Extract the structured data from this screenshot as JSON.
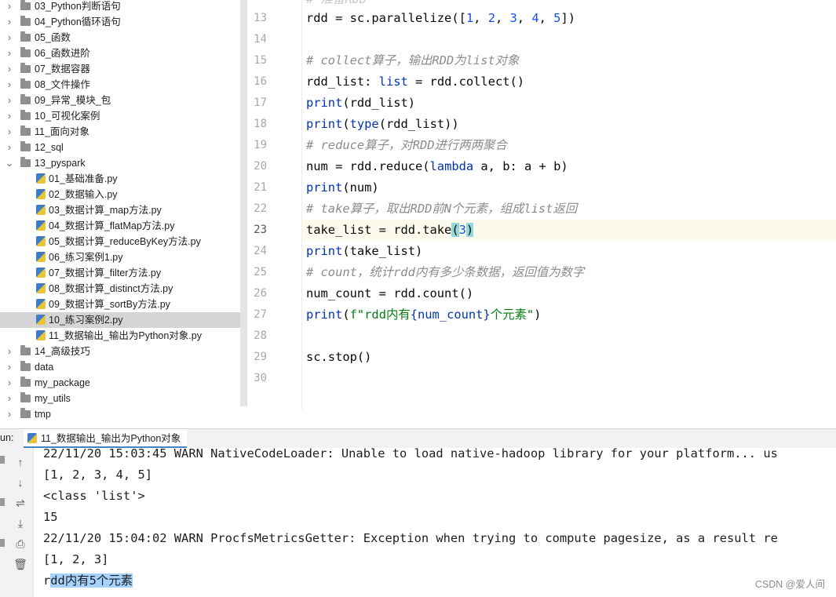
{
  "project_tree": {
    "items": [
      {
        "label": "03_Python判断语句",
        "kind": "folder",
        "expanded": false
      },
      {
        "label": "04_Python循环语句",
        "kind": "folder",
        "expanded": false
      },
      {
        "label": "05_函数",
        "kind": "folder",
        "expanded": false
      },
      {
        "label": "06_函数进阶",
        "kind": "folder",
        "expanded": false
      },
      {
        "label": "07_数据容器",
        "kind": "folder",
        "expanded": false
      },
      {
        "label": "08_文件操作",
        "kind": "folder",
        "expanded": false
      },
      {
        "label": "09_异常_模块_包",
        "kind": "folder",
        "expanded": false
      },
      {
        "label": "10_可视化案例",
        "kind": "folder",
        "expanded": false
      },
      {
        "label": "11_面向对象",
        "kind": "folder",
        "expanded": false
      },
      {
        "label": "12_sql",
        "kind": "folder",
        "expanded": false
      },
      {
        "label": "13_pyspark",
        "kind": "folder",
        "expanded": true
      },
      {
        "label": "01_基础准备.py",
        "kind": "file"
      },
      {
        "label": "02_数据输入.py",
        "kind": "file"
      },
      {
        "label": "03_数据计算_map方法.py",
        "kind": "file"
      },
      {
        "label": "04_数据计算_flatMap方法.py",
        "kind": "file"
      },
      {
        "label": "05_数据计算_reduceByKey方法.py",
        "kind": "file"
      },
      {
        "label": "06_练习案例1.py",
        "kind": "file"
      },
      {
        "label": "07_数据计算_filter方法.py",
        "kind": "file"
      },
      {
        "label": "08_数据计算_distinct方法.py",
        "kind": "file"
      },
      {
        "label": "09_数据计算_sortBy方法.py",
        "kind": "file"
      },
      {
        "label": "10_练习案例2.py",
        "kind": "file",
        "selected": true
      },
      {
        "label": "11_数据输出_输出为Python对象.py",
        "kind": "file"
      },
      {
        "label": "14_高级技巧",
        "kind": "folder",
        "expanded": false
      },
      {
        "label": "data",
        "kind": "folder",
        "expanded": false
      },
      {
        "label": "my_package",
        "kind": "folder",
        "expanded": false
      },
      {
        "label": "my_utils",
        "kind": "folder",
        "expanded": false
      },
      {
        "label": "tmp",
        "kind": "folder",
        "expanded": false
      }
    ]
  },
  "editor": {
    "current_line": 23,
    "line_numbers": [
      "13",
      "14",
      "15",
      "16",
      "17",
      "18",
      "19",
      "20",
      "21",
      "22",
      "23",
      "24",
      "25",
      "26",
      "27",
      "28",
      "29",
      "30"
    ],
    "partial_top_line": "# 准备RDD",
    "code": {
      "l13": {
        "a": "rdd = sc.parallelize([",
        "n1": "1",
        "c1": ", ",
        "n2": "2",
        "c2": ", ",
        "n3": "3",
        "c3": ", ",
        "n4": "4",
        "c4": ", ",
        "n5": "5",
        "b": "])"
      },
      "l15": "# collect算子，输出RDD为list对象",
      "l16": {
        "a": "rdd_list: ",
        "kw": "list",
        "b": " = rdd.collect()"
      },
      "l17": {
        "fn": "print",
        "b": "(rdd_list)"
      },
      "l18": {
        "fn": "print",
        "a": "(",
        "fn2": "type",
        "b": "(rdd_list))"
      },
      "l19": "# reduce算子，对RDD进行两两聚合",
      "l20": {
        "a": "num = rdd.reduce(",
        "kw": "lambda",
        "b": " a, b: a + b)"
      },
      "l21": {
        "fn": "print",
        "b": "(num)"
      },
      "l22": "# take算子，取出RDD前N个元素，组成list返回",
      "l23": {
        "a": "take_list = rdd.take",
        "p1": "(",
        "n": "3",
        "p2": ")"
      },
      "l24": {
        "fn": "print",
        "b": "(take_list)"
      },
      "l25": "# count，统计rdd内有多少条数据，返回值为数字",
      "l26": "num_count = rdd.count()",
      "l27": {
        "fn": "print",
        "p": "(",
        "s1": "f\"rdd内有",
        "i1": "{num_count}",
        "s2": "个元素\"",
        "e": ")"
      },
      "l29": "sc.stop()"
    }
  },
  "run_panel": {
    "prefix": "un:",
    "tab_label": "11_数据输出_输出为Python对象",
    "toolbar_icons": [
      "up-arrow-icon",
      "down-arrow-icon",
      "wrap-icon",
      "scroll-to-end-icon",
      "print-icon",
      "trash-icon"
    ],
    "output_lines": [
      "22/11/20 15:03:45 WARN NativeCodeLoader: Unable to load native-hadoop library for your platform... us",
      "[1, 2, 3, 4, 5]",
      "<class 'list'>",
      "15",
      "22/11/20 15:04:02 WARN ProcfsMetricsGetter: Exception when trying to compute pagesize, as a result re",
      "[1, 2, 3]"
    ],
    "last_line": {
      "plain": "r",
      "selected": "dd内有5个元素"
    }
  },
  "watermark": "CSDN @爱人间",
  "colors": {
    "keyword": "#0033b3",
    "number": "#1750eb",
    "comment": "#8c8c8c",
    "string": "#067d17",
    "selection": "#a6d2ff",
    "current_line": "#fcfaed"
  }
}
